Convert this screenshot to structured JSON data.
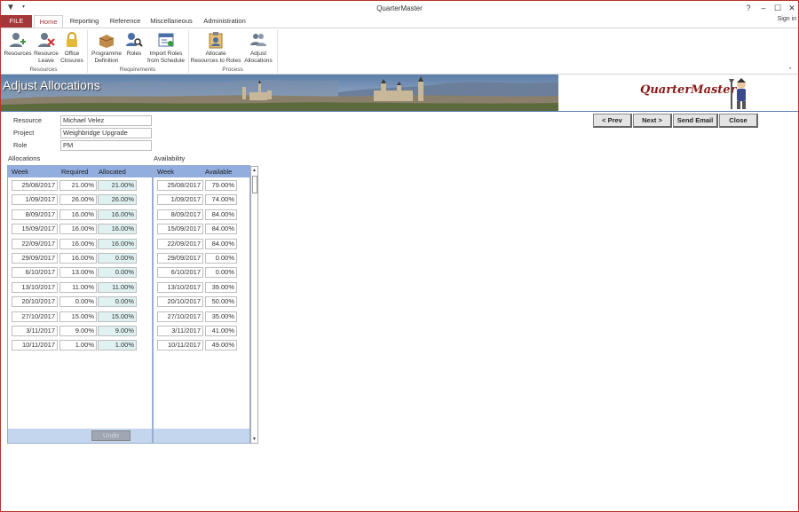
{
  "window": {
    "title": "QuarterMaster",
    "help": "?",
    "minimize": "‒",
    "maximize": "☐",
    "close": "✕",
    "sign_in": "Sign in"
  },
  "tabs": {
    "file": "FILE",
    "home": "Home",
    "reporting": "Reporting",
    "reference": "Reference",
    "miscellaneous": "Miscellaneous",
    "administration": "Administration"
  },
  "ribbon": {
    "resources": "Resources",
    "resource_leave_1": "Resource",
    "resource_leave_2": "Leave",
    "office_closures_1": "Office",
    "office_closures_2": "Closures",
    "programme_def_1": "Programme",
    "programme_def_2": "Definition",
    "roles": "Roles",
    "import_roles_1": "Import Roles",
    "import_roles_2": "from Schedule",
    "allocate_1": "Allocate",
    "allocate_2": "Resources to Roles",
    "adjust_1": "Adjust",
    "adjust_2": "Allocations",
    "group_resources": "Resources",
    "group_requirements": "Requirements",
    "group_process": "Process"
  },
  "banner": {
    "title": "Adjust Allocations",
    "logo": "QuarterMaster"
  },
  "form": {
    "resource_label": "Resource",
    "resource_value": "Michael Velez",
    "project_label": "Project",
    "project_value": "Weighbridge Upgrade",
    "role_label": "Role",
    "role_value": "PM"
  },
  "buttons": {
    "prev": "< Prev",
    "next": "Next >",
    "send_email": "Send Email",
    "close": "Close",
    "undo": "Undo"
  },
  "allocations": {
    "title": "Allocations",
    "headers": {
      "week": "Week",
      "required": "Required",
      "allocated": "Allocated"
    },
    "rows": [
      {
        "week": "25/08/2017",
        "required": "21.00%",
        "allocated": "21.00%"
      },
      {
        "week": "1/09/2017",
        "required": "26.00%",
        "allocated": "26.00%"
      },
      {
        "week": "8/09/2017",
        "required": "16.00%",
        "allocated": "16.00%"
      },
      {
        "week": "15/09/2017",
        "required": "16.00%",
        "allocated": "16.00%"
      },
      {
        "week": "22/09/2017",
        "required": "16.00%",
        "allocated": "16.00%"
      },
      {
        "week": "29/09/2017",
        "required": "16.00%",
        "allocated": "0.00%"
      },
      {
        "week": "6/10/2017",
        "required": "13.00%",
        "allocated": "0.00%"
      },
      {
        "week": "13/10/2017",
        "required": "11.00%",
        "allocated": "11.00%"
      },
      {
        "week": "20/10/2017",
        "required": "0.00%",
        "allocated": "0.00%"
      },
      {
        "week": "27/10/2017",
        "required": "15.00%",
        "allocated": "15.00%"
      },
      {
        "week": "3/11/2017",
        "required": "9.00%",
        "allocated": "9.00%"
      },
      {
        "week": "10/11/2017",
        "required": "1.00%",
        "allocated": "1.00%"
      }
    ]
  },
  "availability": {
    "title": "Availability",
    "headers": {
      "week": "Week",
      "available": "Available"
    },
    "rows": [
      {
        "week": "25/08/2017",
        "available": "79.00%"
      },
      {
        "week": "1/09/2017",
        "available": "74.00%"
      },
      {
        "week": "8/09/2017",
        "available": "84.00%"
      },
      {
        "week": "15/09/2017",
        "available": "84.00%"
      },
      {
        "week": "22/09/2017",
        "available": "84.00%"
      },
      {
        "week": "29/09/2017",
        "available": "0.00%"
      },
      {
        "week": "6/10/2017",
        "available": "0.00%"
      },
      {
        "week": "13/10/2017",
        "available": "39.00%"
      },
      {
        "week": "20/10/2017",
        "available": "50.00%"
      },
      {
        "week": "27/10/2017",
        "available": "35.00%"
      },
      {
        "week": "3/11/2017",
        "available": "41.00%"
      },
      {
        "week": "10/11/2017",
        "available": "49.00%"
      }
    ]
  },
  "colors": {
    "accent": "#a4373a",
    "header_blue": "#91aede",
    "alloc_cell": "#e0f1f2"
  },
  "icons": [
    "app-icon",
    "resources-icon",
    "resource-leave-icon",
    "lock-icon",
    "box-icon",
    "roles-search-icon",
    "import-schedule-icon",
    "allocate-clipboard-icon",
    "adjust-users-icon"
  ]
}
